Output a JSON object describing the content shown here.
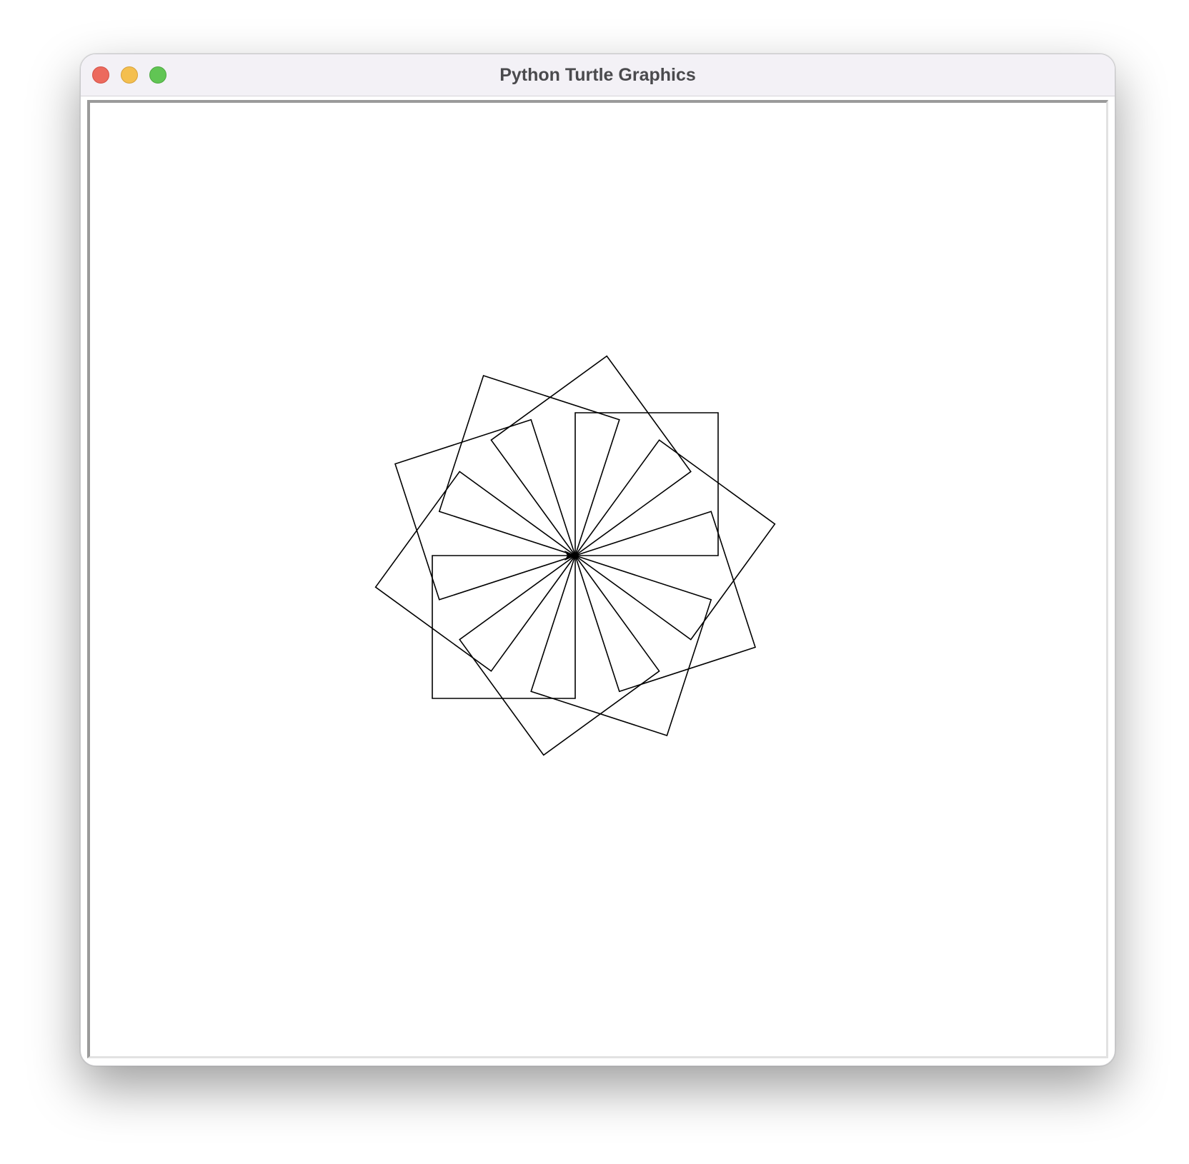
{
  "window": {
    "title": "Python Turtle Graphics"
  },
  "window_controls": [
    "close",
    "minimize",
    "zoom"
  ],
  "colors": {
    "titlebar": "#f3f1f6",
    "close": "#ec6a5e",
    "minimize": "#f4bf4f",
    "zoom": "#61c554",
    "canvas": "#ffffff",
    "pen": "#000000"
  },
  "drawing": {
    "shape": "square",
    "square_count": 10,
    "rotation_step_degrees": 36,
    "turtle_cursor": "arrow",
    "turtle_heading_degrees": 0
  }
}
